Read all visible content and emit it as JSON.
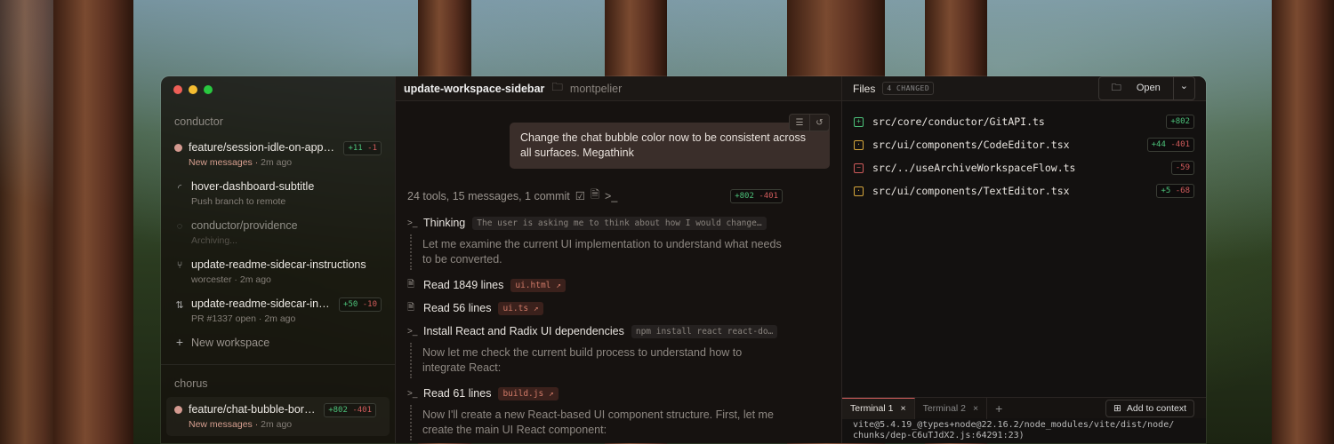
{
  "sidebar": {
    "groups": [
      {
        "name": "conductor",
        "items": [
          {
            "title": "feature/session-idle-on-app-…",
            "subtitle": "New messages",
            "time": "2m ago",
            "add": "+11",
            "del": "-1"
          },
          {
            "title": "hover-dashboard-subtitle",
            "subtitle": "Push branch to remote"
          },
          {
            "title": "conductor/providence",
            "subtitle": "Archiving..."
          },
          {
            "title": "update-readme-sidecar-instructions",
            "subtitle": "worcester",
            "time": "2m ago"
          },
          {
            "title": "update-readme-sidecar-ins…",
            "subtitle": "PR #1337 open",
            "time": "2m ago",
            "add": "+50",
            "del": "-10"
          }
        ],
        "new_workspace": "New workspace"
      },
      {
        "name": "chorus",
        "items": [
          {
            "title": "feature/chat-bubble-border",
            "subtitle": "New messages",
            "time": "2m ago",
            "add": "+802",
            "del": "-401"
          }
        ]
      }
    ]
  },
  "chat": {
    "title": "update-workspace-sidebar",
    "location": "montpelier",
    "message": "Change the chat bubble color now to be consistent across all surfaces. Megathink",
    "summary": "24 tools, 15 messages, 1 commit",
    "add": "+802",
    "del": "-401",
    "thinking_label": "Thinking",
    "thinking_preview": "The user is asking me to think about how I would change…",
    "note1": "Let me examine the current UI implementation to understand what needs to be converted.",
    "read1": "Read 1849 lines",
    "read1_file": "ui.html ↗",
    "read2": "Read 56 lines",
    "read2_file": "ui.ts ↗",
    "install": "Install React and Radix UI dependencies",
    "install_cmd": "npm install react react-do…",
    "note2": "Now let me check the current build process to understand how to integrate React:",
    "read3": "Read 61 lines",
    "read3_file": "build.js ↗",
    "note3": "Now I'll create a new React-based UI component structure. First, let me create the main UI React component:"
  },
  "files": {
    "title": "Files",
    "changed": "4 CHANGED",
    "open": "Open",
    "list": [
      {
        "path": "src/core/conductor/GitAPI.ts",
        "status": "added",
        "add": "+802",
        "del": ""
      },
      {
        "path": "src/ui/components/CodeEditor.tsx",
        "status": "modified",
        "add": "+44",
        "del": "-401"
      },
      {
        "path": "src/../useArchiveWorkspaceFlow.ts",
        "status": "deleted",
        "add": "",
        "del": "-59"
      },
      {
        "path": "src/ui/components/TextEditor.tsx",
        "status": "modified",
        "add": "+5",
        "del": "-68"
      }
    ],
    "terminal_tabs": [
      "Terminal 1",
      "Terminal 2"
    ],
    "add_to_context": "Add to context",
    "terminal_lines": [
      "vite@5.4.19_@types+node@22.16.2/node_modules/vite/dist/node/",
      "chunks/dep-C6uTJdX2.js:64291:23)"
    ]
  },
  "colors": {
    "add": "#4cc27a",
    "del": "#d05b5b",
    "modified": "#d6a63c"
  }
}
